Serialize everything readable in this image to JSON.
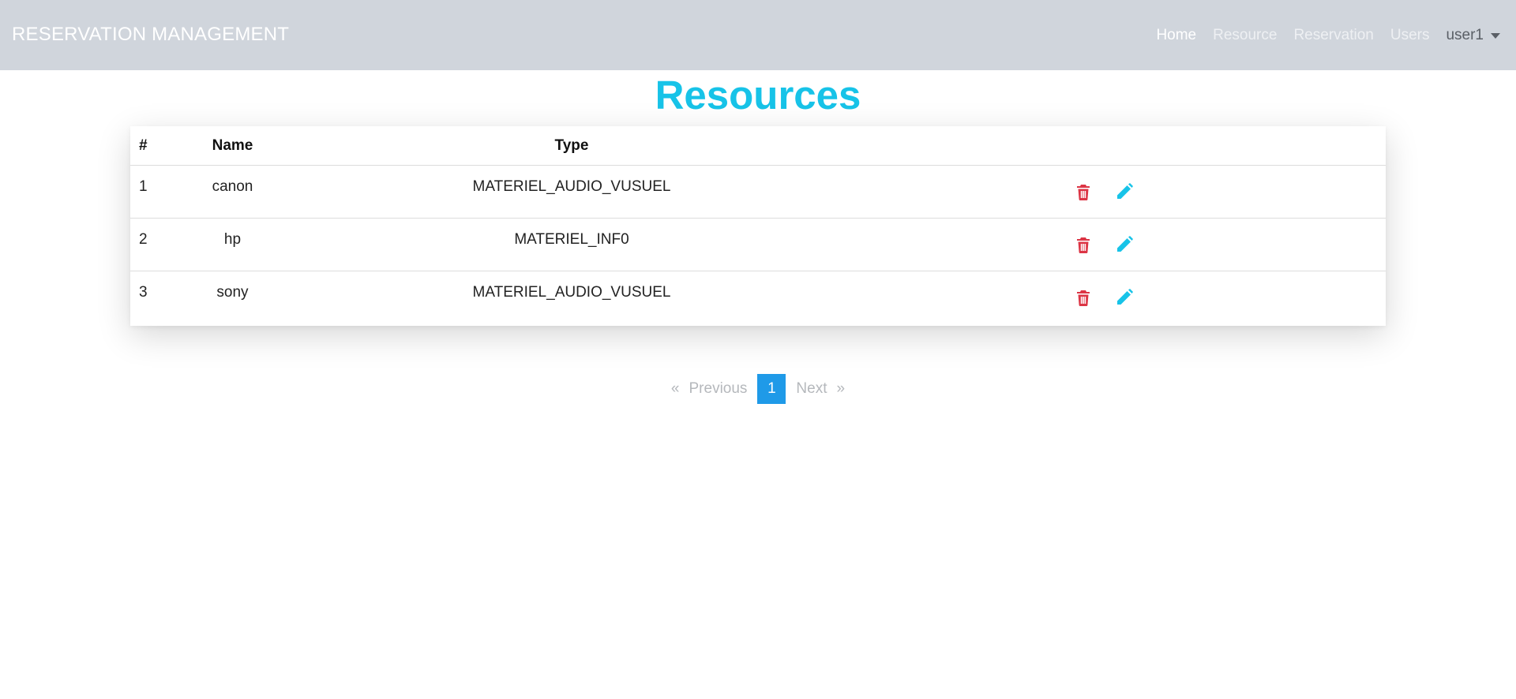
{
  "navbar": {
    "brand": "RESERVATION MANAGEMENT",
    "links": [
      {
        "label": "Home",
        "active": true
      },
      {
        "label": "Resource",
        "active": false
      },
      {
        "label": "Reservation",
        "active": false
      },
      {
        "label": "Users",
        "active": false
      }
    ],
    "user": "user1"
  },
  "page": {
    "title": "Resources"
  },
  "table": {
    "headers": {
      "id": "#",
      "name": "Name",
      "type": "Type"
    },
    "rows": [
      {
        "id": "1",
        "name": "canon",
        "type": "MATERIEL_AUDIO_VUSUEL"
      },
      {
        "id": "2",
        "name": "hp",
        "type": "MATERIEL_INF0"
      },
      {
        "id": "3",
        "name": "sony",
        "type": "MATERIEL_AUDIO_VUSUEL"
      }
    ],
    "actions": {
      "delete_icon": "trash-icon",
      "edit_icon": "pencil-icon"
    }
  },
  "pagination": {
    "first": "«",
    "previous": "Previous",
    "current": "1",
    "next": "Next",
    "last": "»"
  },
  "colors": {
    "navbar_bg": "#d0d5dc",
    "title": "#17c3e8",
    "delete": "#dc3545",
    "edit": "#17c3e8",
    "pagination_active": "#1f9ae8"
  }
}
